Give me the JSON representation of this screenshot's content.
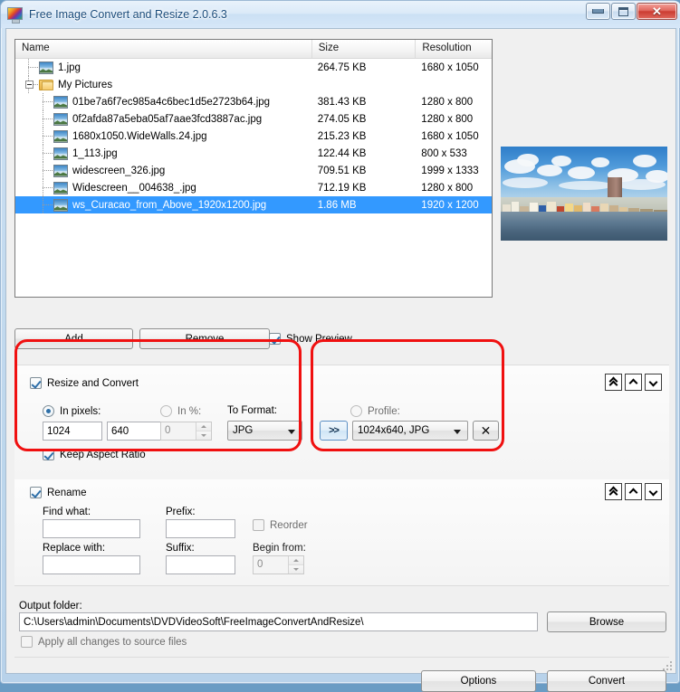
{
  "window": {
    "title": "Free Image Convert and Resize 2.0.6.3",
    "icon": "picture-monitor-icon",
    "buttons": {
      "minimize": "minimize-icon",
      "maximize": "maximize-icon",
      "close": "✕"
    }
  },
  "filelist": {
    "columns": [
      "Name",
      "Size",
      "Resolution"
    ],
    "rows": [
      {
        "indent": 1,
        "icon": "image-icon",
        "name": "1.jpg",
        "size": "264.75 KB",
        "resolution": "1680 x 1050",
        "selected": false
      },
      {
        "indent": 1,
        "icon": "folder-icon",
        "name": "My Pictures",
        "size": "",
        "resolution": "",
        "selected": false,
        "expander": true
      },
      {
        "indent": 2,
        "icon": "image-icon",
        "name": "01be7a6f7ec985a4c6bec1d5e2723b64.jpg",
        "size": "381.43 KB",
        "resolution": "1280 x 800",
        "selected": false
      },
      {
        "indent": 2,
        "icon": "image-icon",
        "name": "0f2afda87a5eba05af7aae3fcd3887ac.jpg",
        "size": "274.05 KB",
        "resolution": "1280 x 800",
        "selected": false
      },
      {
        "indent": 2,
        "icon": "image-icon",
        "name": "1680x1050.WideWalls.24.jpg",
        "size": "215.23 KB",
        "resolution": "1680 x 1050",
        "selected": false
      },
      {
        "indent": 2,
        "icon": "image-icon",
        "name": "1_113.jpg",
        "size": "122.44 KB",
        "resolution": "800 x 533",
        "selected": false
      },
      {
        "indent": 2,
        "icon": "image-icon",
        "name": "widescreen_326.jpg",
        "size": "709.51 KB",
        "resolution": "1999 x 1333",
        "selected": false
      },
      {
        "indent": 2,
        "icon": "image-icon",
        "name": "Widescreen__004638_.jpg",
        "size": "712.19 KB",
        "resolution": "1280 x 800",
        "selected": false
      },
      {
        "indent": 2,
        "icon": "image-icon",
        "name": "ws_Curacao_from_Above_1920x1200.jpg",
        "size": "1.86 MB",
        "resolution": "1920 x 1200",
        "selected": true
      }
    ]
  },
  "toolbar": {
    "add_label": "Add",
    "remove_label": "Remove",
    "show_preview_label": "Show Preview",
    "show_preview_checked": true
  },
  "resize_section": {
    "title": "Resize and Convert",
    "enabled": true,
    "in_pixels_label": "In pixels:",
    "in_pixels_selected": true,
    "width_value": "1024",
    "height_value": "640",
    "in_percent_label": "In %:",
    "in_percent_selected": false,
    "percent_value": "0",
    "to_format_label": "To Format:",
    "format_value": "JPG",
    "keep_aspect_label": "Keep Aspect Ratio",
    "keep_aspect_checked": true
  },
  "profile_section": {
    "label": "Profile:",
    "selected": false,
    "apply_button": ">>",
    "value": "1024x640, JPG",
    "delete_button": "✕"
  },
  "rename_section": {
    "title": "Rename",
    "enabled": true,
    "find_what_label": "Find what:",
    "find_what_value": "",
    "replace_with_label": "Replace with:",
    "replace_with_value": "",
    "prefix_label": "Prefix:",
    "prefix_value": "",
    "suffix_label": "Suffix:",
    "suffix_value": "",
    "reorder_label": "Reorder",
    "reorder_checked": false,
    "begin_from_label": "Begin from:",
    "begin_from_value": "0"
  },
  "output": {
    "label": "Output folder:",
    "path": "C:\\Users\\admin\\Documents\\DVDVideoSoft\\FreeImageConvertAndResize\\",
    "browse_label": "Browse",
    "apply_all_label": "Apply all changes to source files",
    "apply_all_checked": false
  },
  "footer": {
    "options_label": "Options",
    "convert_label": "Convert"
  },
  "colors": {
    "selection": "#3399ff",
    "annotation": "#f01010",
    "title_text": "#184a7a"
  }
}
